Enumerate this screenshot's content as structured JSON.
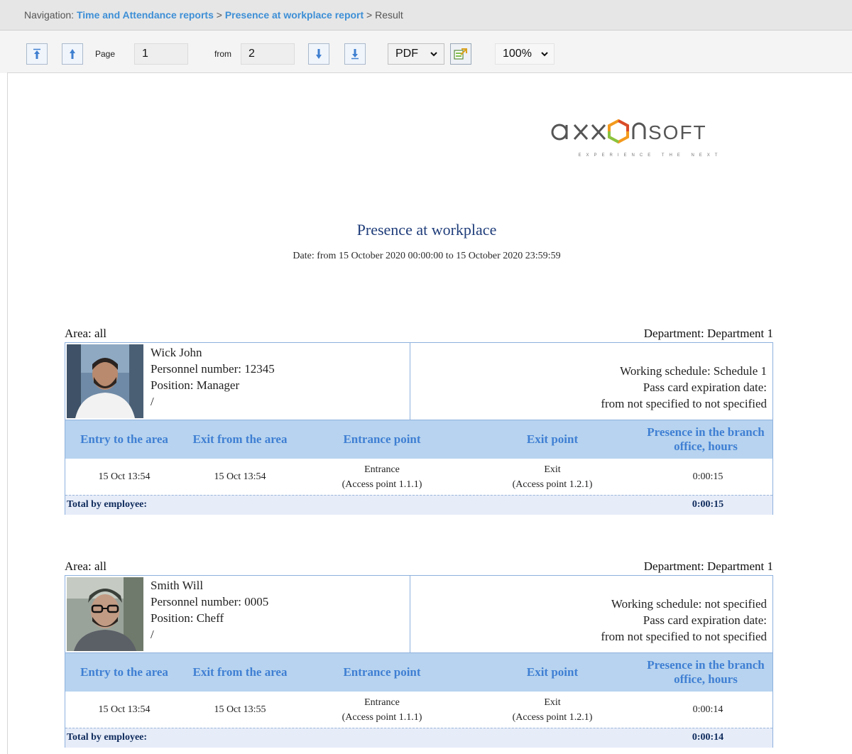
{
  "nav": {
    "prefix": "Navigation:",
    "link1": "Time and Attendance reports",
    "sep1": ">",
    "link2": "Presence at workplace report",
    "sep2": ">",
    "current": "Result"
  },
  "toolbar": {
    "first_icon": "first-page-icon",
    "prev_icon": "previous-page-icon",
    "page_label": "Page",
    "page_value": "1",
    "from_label": "from",
    "total_pages": "2",
    "next_icon": "next-page-icon",
    "last_icon": "last-page-icon",
    "format_value": "PDF",
    "export_icon": "export-icon",
    "zoom_value": "100%"
  },
  "report": {
    "logo_text": "axxonsoft",
    "logo_tagline": "EXPERIENCE THE NEXT",
    "title": "Presence at workplace",
    "date": "Date: from 15 October 2020 00:00:00 to 15 October 2020 23:59:59",
    "columns": [
      "Entry to the area",
      "Exit from the area",
      "Entrance point",
      "Exit point",
      "Presence in the branch office, hours"
    ],
    "employees": [
      {
        "area": "Area: all",
        "department": "Department: Department 1",
        "name": "Wick John",
        "personnel": "Personnel number: 12345",
        "position": "Position: Manager",
        "extra": "/",
        "schedule": "Working schedule: Schedule 1",
        "pass_label": "Pass card expiration date:",
        "pass_value": "from not specified to not specified",
        "rows": [
          {
            "entry": "15 Oct 13:54",
            "exit": "15 Oct 13:54",
            "entrance_point": "Entrance",
            "entrance_ap": "(Access point 1.1.1)",
            "exit_point": "Exit",
            "exit_ap": "(Access point 1.2.1)",
            "presence": "0:00:15"
          }
        ],
        "total_label": "Total by employee:",
        "total_value": "0:00:15"
      },
      {
        "area": "Area: all",
        "department": "Department: Department 1",
        "name": "Smith Will",
        "personnel": "Personnel number: 0005",
        "position": "Position: Cheff",
        "extra": "/",
        "schedule": "Working schedule: not specified",
        "pass_label": "Pass card expiration date:",
        "pass_value": "from not specified to not specified",
        "rows": [
          {
            "entry": "15 Oct 13:54",
            "exit": "15 Oct 13:55",
            "entrance_point": "Entrance",
            "entrance_ap": "(Access point 1.1.1)",
            "exit_point": "Exit",
            "exit_ap": "(Access point 1.2.1)",
            "presence": "0:00:14"
          }
        ],
        "total_label": "Total by employee:",
        "total_value": "0:00:14"
      }
    ]
  }
}
